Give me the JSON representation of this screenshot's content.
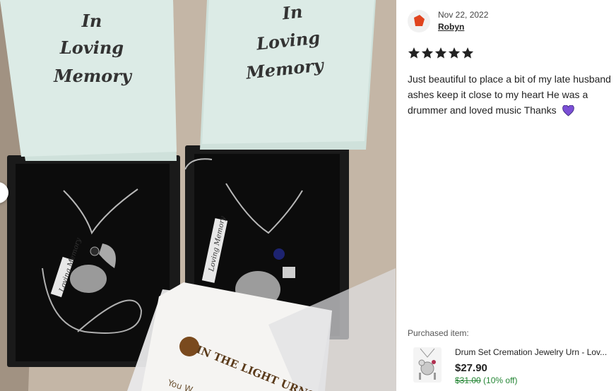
{
  "photo": {
    "box_lid_text": [
      "In",
      "Loving",
      "Memory"
    ],
    "tag_text": "Loving Memory",
    "card_text": "IN THE LIGHT URNS",
    "card_line": "You W"
  },
  "review": {
    "date": "Nov 22, 2022",
    "reviewer": "Robyn",
    "rating": 5,
    "text": "Just beautiful to place a bit of my late husband ashes keep it close to my heart He was a drummer and loved music Thanks",
    "heart_icon": "purple-heart-icon",
    "star_color": "#222222",
    "heart_color": "#7b4fd6",
    "avatar_color": "#e0441e"
  },
  "purchase": {
    "label": "Purchased item:",
    "title": "Drum Set Cremation Jewelry Urn - Lov...",
    "price": "$27.90",
    "old_price": "$31.00",
    "discount": "(10% off)",
    "discount_color": "#258635"
  }
}
